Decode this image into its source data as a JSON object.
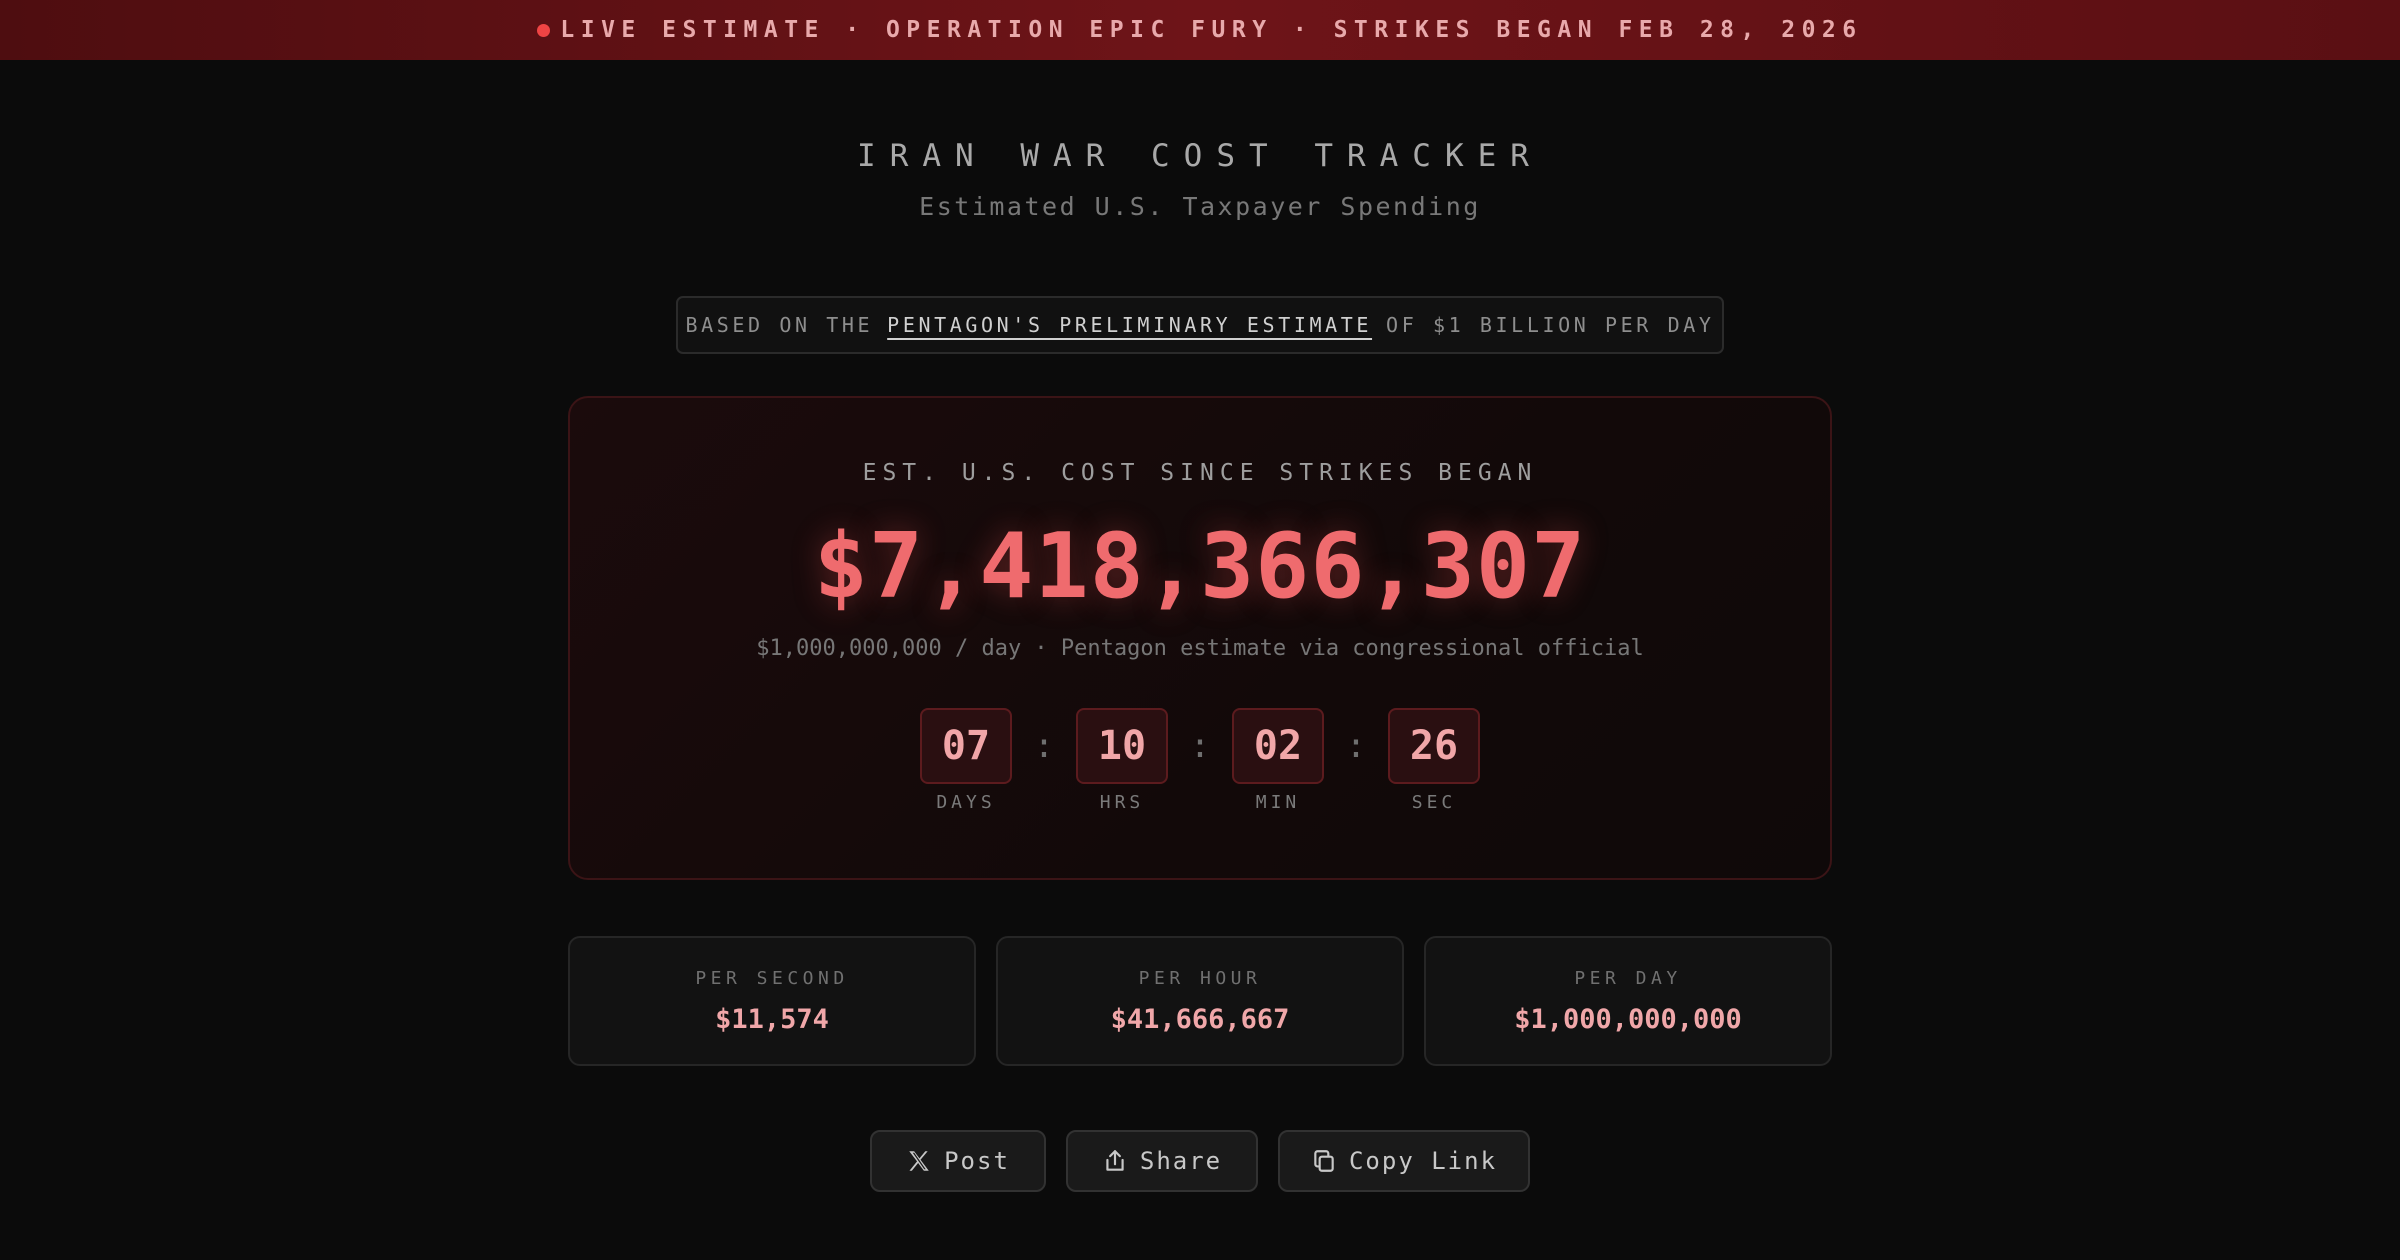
{
  "banner": {
    "text": "LIVE ESTIMATE · OPERATION EPIC FURY · STRIKES BEGAN FEB 28, 2026"
  },
  "header": {
    "title": "IRAN WAR COST TRACKER",
    "subtitle": "Estimated U.S. Taxpayer Spending"
  },
  "source": {
    "prefix": "BASED ON THE",
    "link_text": "PENTAGON'S PRELIMINARY ESTIMATE",
    "suffix": "OF $1 BILLION PER DAY"
  },
  "main_card": {
    "label": "EST. U.S. COST SINCE STRIKES BEGAN",
    "amount": "$7,418,366,307",
    "rate_note": "$1,000,000,000 / day · Pentagon estimate via congressional official",
    "countdown": {
      "days": "07",
      "days_label": "DAYS",
      "hours": "10",
      "hours_label": "HRS",
      "minutes": "02",
      "minutes_label": "MIN",
      "seconds": "26",
      "seconds_label": "SEC",
      "separator": ":"
    }
  },
  "stats": [
    {
      "label": "PER SECOND",
      "value": "$11,574"
    },
    {
      "label": "PER HOUR",
      "value": "$41,666,667"
    },
    {
      "label": "PER DAY",
      "value": "$1,000,000,000"
    }
  ],
  "actions": {
    "post_label": "Post",
    "share_label": "Share",
    "copy_label": "Copy Link"
  },
  "colors": {
    "accent": "#ef6b6e",
    "banner": "#6e1418",
    "background": "#0b0b0b",
    "live_dot": "#ef4444"
  },
  "icons": {
    "live": "live-dot-icon",
    "post": "x-logo-icon",
    "share": "share-icon",
    "copy": "copy-icon"
  }
}
